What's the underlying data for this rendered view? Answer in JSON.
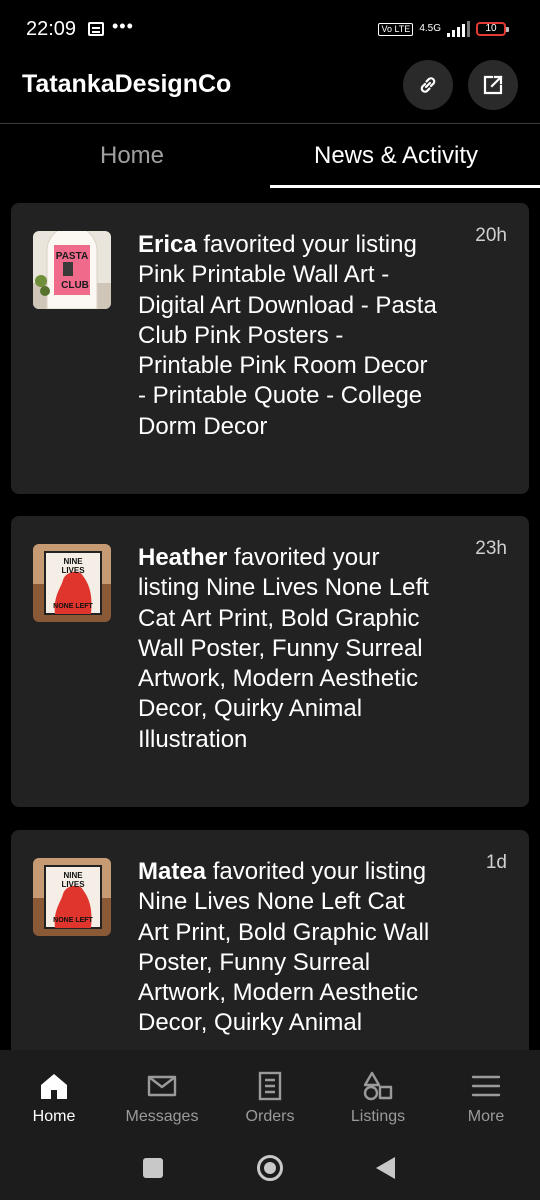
{
  "status_bar": {
    "time": "22:09",
    "volte": "Vo LTE",
    "network": "4.5G",
    "battery": "10",
    "icons": [
      "notification-icon",
      "more-dots-icon",
      "signal-icon",
      "battery-icon"
    ]
  },
  "header": {
    "shop_name": "TatankaDesignCo",
    "link_icon": "link-icon",
    "share_icon": "share-icon"
  },
  "tabs": [
    {
      "label": "Home",
      "active": false
    },
    {
      "label": "News & Activity",
      "active": true
    }
  ],
  "feed": [
    {
      "user": "Erica",
      "message": " favorited your listing Pink Printable Wall Art - Digital Art Download - Pasta Club Pink Posters - Printable Pink Room Decor - Printable Quote - College Dorm Decor",
      "time": "20h",
      "thumb_text": [
        "PASTA",
        "CLUB"
      ]
    },
    {
      "user": "Heather",
      "message": " favorited your listing Nine Lives None Left Cat Art Print, Bold Graphic Wall Poster, Funny Surreal Artwork, Modern Aesthetic Decor, Quirky Animal Illustration",
      "time": "23h",
      "thumb_text": [
        "NINE",
        "LIVES",
        "NONE LEFT"
      ]
    },
    {
      "user": "Matea",
      "message": " favorited your listing Nine Lives None Left Cat Art Print, Bold Graphic Wall Poster, Funny Surreal Artwork, Modern Aesthetic Decor, Quirky Animal",
      "time": "1d",
      "thumb_text": [
        "NINE",
        "LIVES",
        "NONE LEFT"
      ]
    }
  ],
  "bottom_nav": [
    {
      "label": "Home",
      "icon": "home-icon",
      "active": true
    },
    {
      "label": "Messages",
      "icon": "messages-icon",
      "active": false
    },
    {
      "label": "Orders",
      "icon": "orders-icon",
      "active": false
    },
    {
      "label": "Listings",
      "icon": "listings-icon",
      "active": false
    },
    {
      "label": "More",
      "icon": "menu-icon",
      "active": false
    }
  ],
  "colors": {
    "background": "#000000",
    "card": "#222222",
    "nav_bg": "#1c1c1c",
    "active_text": "#ffffff",
    "inactive_text": "#9a9a9a"
  }
}
